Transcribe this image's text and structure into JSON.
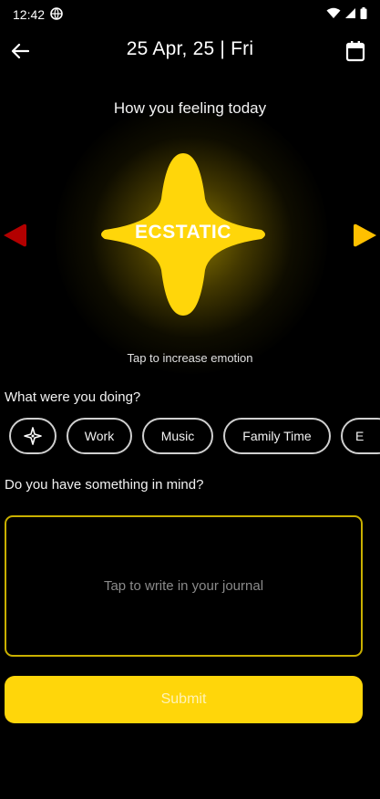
{
  "status_bar": {
    "time": "12:42"
  },
  "header": {
    "date_title": "25 Apr, 25 | Fri"
  },
  "mood": {
    "question": "How you feeling today",
    "emotion": "ECSTATIC",
    "hint": "Tap to increase emotion",
    "colors": {
      "star": "#ffd60a",
      "prev_arrow": "#b30000",
      "next_arrow": "#ffc000"
    }
  },
  "activities": {
    "label": "What were you doing?",
    "chips": [
      "Work",
      "Music",
      "Family Time",
      "E"
    ]
  },
  "journal": {
    "label": "Do you have something in mind?",
    "placeholder": "Tap to write in your journal"
  },
  "submit": {
    "label": "Submit"
  },
  "theme": {
    "accent": "#ffd60a",
    "background": "#000000"
  }
}
